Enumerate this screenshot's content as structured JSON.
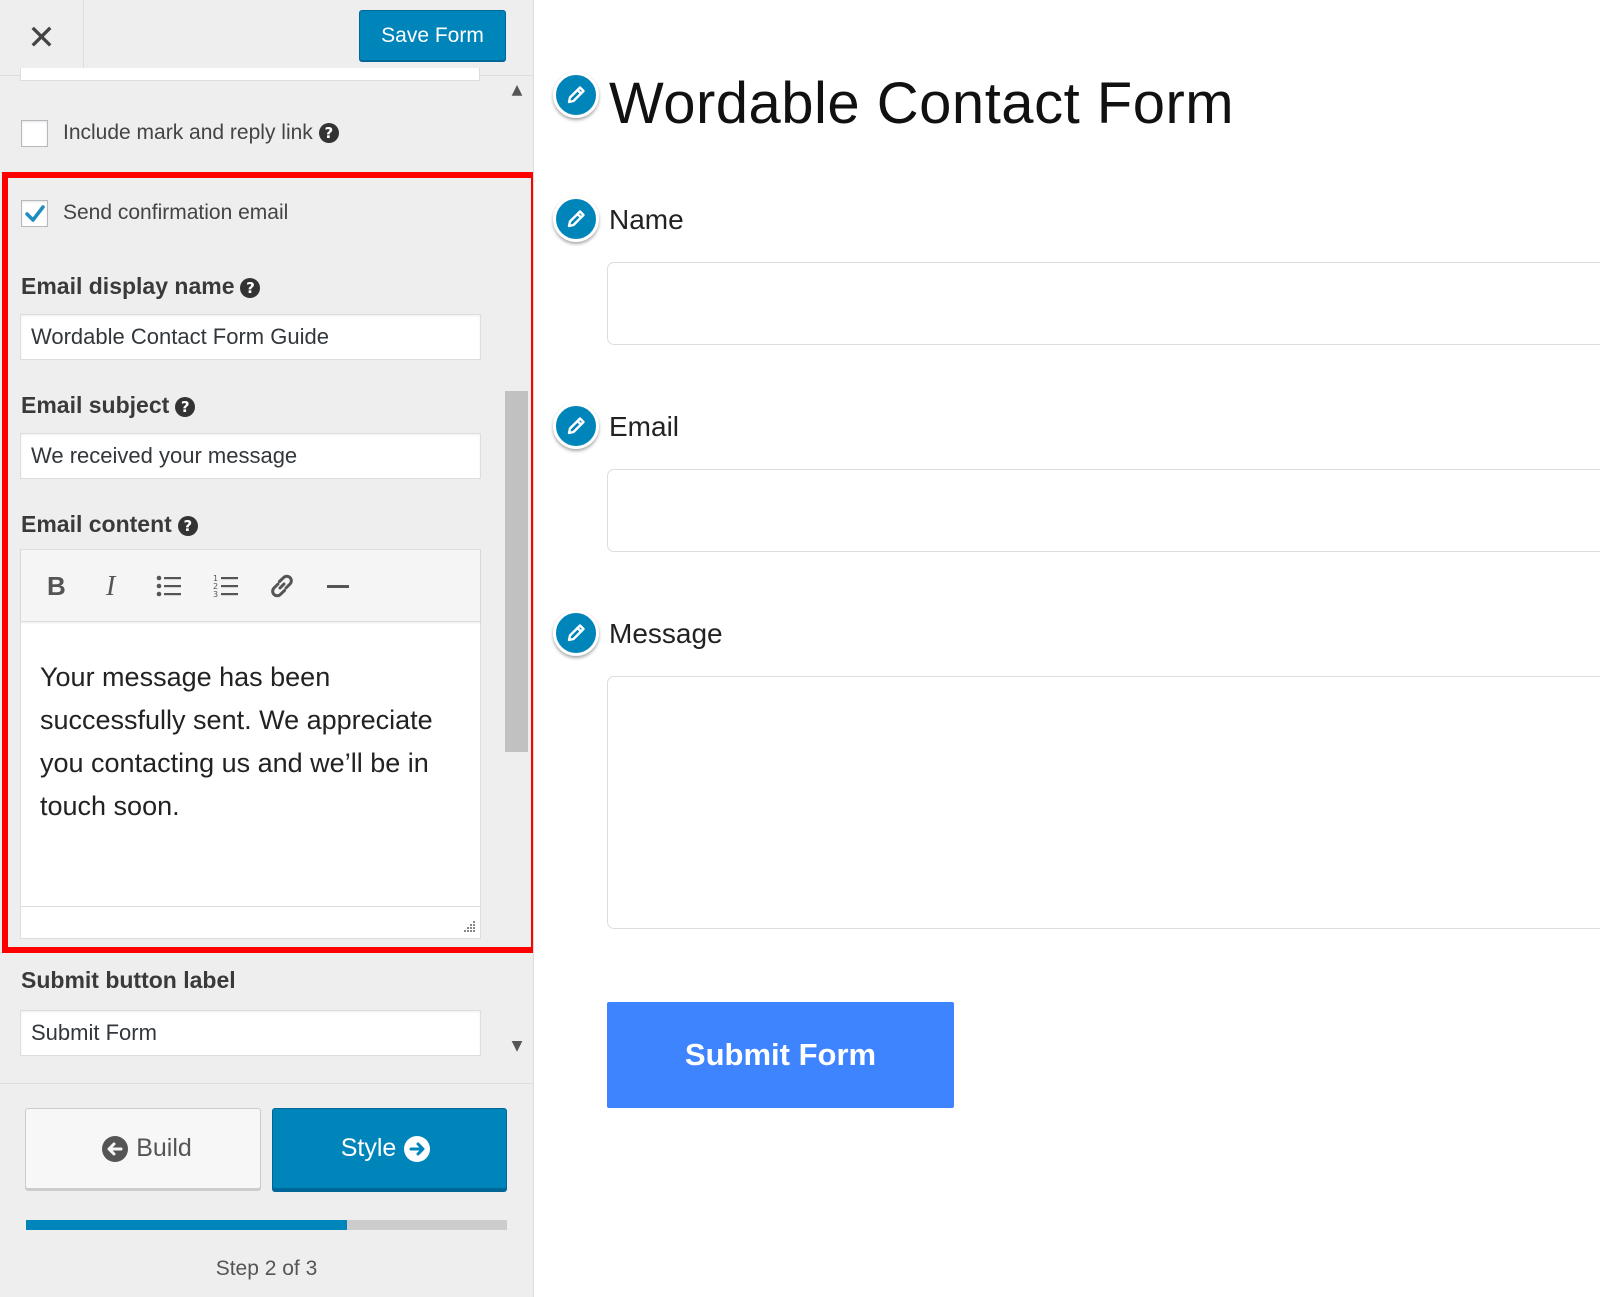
{
  "sidebar": {
    "close_glyph": "✕",
    "save_label": "Save Form",
    "include_mark_reply": {
      "label": "Include mark and reply link",
      "checked": false
    },
    "send_confirmation": {
      "label": "Send confirmation email",
      "checked": true
    },
    "email_display_name": {
      "label": "Email display name",
      "value": "Wordable Contact Form Guide"
    },
    "email_subject": {
      "label": "Email subject",
      "value": "We received your message"
    },
    "email_content": {
      "label": "Email content",
      "toolbar": [
        "bold-icon",
        "italic-icon",
        "bullet-list-icon",
        "numbered-list-icon",
        "link-icon",
        "horizontal-rule-icon"
      ],
      "body": "Your message has been successfully sent. We appreciate you contacting us and we’ll be in touch soon."
    },
    "submit_button_label": {
      "label": "Submit button label",
      "value": "Submit Form"
    },
    "help_glyph": "?",
    "nav": {
      "build_label": "Build",
      "style_label": "Style"
    },
    "progress": {
      "fraction": 0.667,
      "step_text": "Step 2 of 3"
    }
  },
  "preview": {
    "title": "Wordable Contact Form",
    "fields": [
      {
        "label": "Name"
      },
      {
        "label": "Email"
      },
      {
        "label": "Message"
      }
    ],
    "submit_label": "Submit Form"
  },
  "colors": {
    "accent": "#0085ba",
    "submit_button": "#3f84ff",
    "highlight": "#ff0000",
    "sidebar_bg": "#eeeeee"
  }
}
